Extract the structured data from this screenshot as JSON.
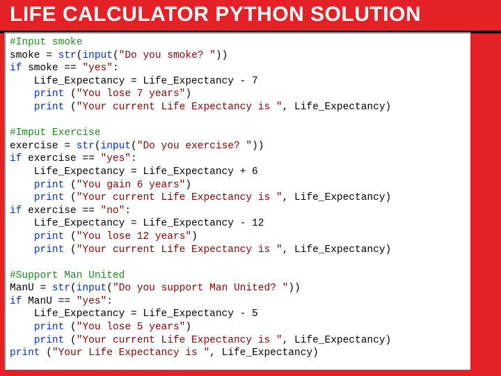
{
  "title": "LIFE CALCULATOR PYTHON SOLUTION",
  "code": {
    "l01": "#Input smoke",
    "l02a": "smoke = ",
    "l02b": "str",
    "l02c": "(",
    "l02d": "input",
    "l02e": "(",
    "l02f": "\"Do you smoke? \"",
    "l02g": "))",
    "l03a": "if",
    "l03b": " smoke == ",
    "l03c": "\"yes\"",
    "l03d": ":",
    "l04": "    Life_Expectancy = Life_Expectancy - 7",
    "l05a": "    ",
    "l05b": "print",
    "l05c": " (",
    "l05d": "\"You lose 7 years\"",
    "l05e": ")",
    "l06a": "    ",
    "l06b": "print",
    "l06c": " (",
    "l06d": "\"Your current Life Expectancy is \"",
    "l06e": ", Life_Expectancy)",
    "l07": "",
    "l08": "#Imput Exercise",
    "l09a": "exercise = ",
    "l09b": "str",
    "l09c": "(",
    "l09d": "input",
    "l09e": "(",
    "l09f": "\"Do you exercise? \"",
    "l09g": "))",
    "l10a": "if",
    "l10b": " exercise == ",
    "l10c": "\"yes\"",
    "l10d": ":",
    "l11": "    Life_Expectancy = Life_Expectancy + 6",
    "l12a": "    ",
    "l12b": "print",
    "l12c": " (",
    "l12d": "\"You gain 6 years\"",
    "l12e": ")",
    "l13a": "    ",
    "l13b": "print",
    "l13c": " (",
    "l13d": "\"Your current Life Expectancy is \"",
    "l13e": ", Life_Expectancy)",
    "l14a": "if",
    "l14b": " exercise == ",
    "l14c": "\"no\"",
    "l14d": ":",
    "l15": "    Life_Expectancy = Life_Expectancy - 12",
    "l16a": "    ",
    "l16b": "print",
    "l16c": " (",
    "l16d": "\"You lose 12 years\"",
    "l16e": ")",
    "l17a": "    ",
    "l17b": "print",
    "l17c": " (",
    "l17d": "\"Your current Life Expectancy is \"",
    "l17e": ", Life_Expectancy)",
    "l18": "",
    "l19": "#Support Man United",
    "l20a": "ManU = ",
    "l20b": "str",
    "l20c": "(",
    "l20d": "input",
    "l20e": "(",
    "l20f": "\"Do you support Man United? \"",
    "l20g": "))",
    "l21a": "if",
    "l21b": " ManU == ",
    "l21c": "\"yes\"",
    "l21d": ":",
    "l22": "    Life_Expectancy = Life_Expectancy - 5",
    "l23a": "    ",
    "l23b": "print",
    "l23c": " (",
    "l23d": "\"You lose 5 years\"",
    "l23e": ")",
    "l24a": "    ",
    "l24b": "print",
    "l24c": " (",
    "l24d": "\"Your current Life Expectancy is \"",
    "l24e": ", Life_Expectancy)",
    "l25a": "print",
    "l25b": " (",
    "l25c": "\"Your Life Expectancy is \"",
    "l25d": ", Life_Expectancy)"
  }
}
